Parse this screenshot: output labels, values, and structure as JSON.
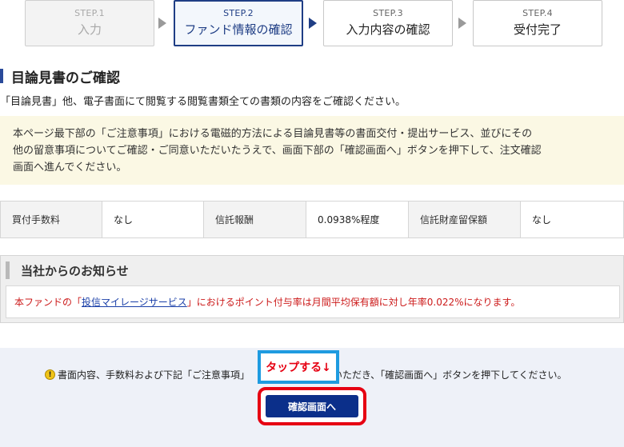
{
  "steps": [
    {
      "num": "STEP.1",
      "label": "入力",
      "state": "done"
    },
    {
      "num": "STEP.2",
      "label": "ファンド情報の確認",
      "state": "active"
    },
    {
      "num": "STEP.3",
      "label": "入力内容の確認",
      "state": "upcoming"
    },
    {
      "num": "STEP.4",
      "label": "受付完了",
      "state": "upcoming"
    }
  ],
  "heading": "目論見書のご確認",
  "intro": "「目論見書」他、電子書面にて閲覧する閲覧書類全ての書類の内容をご確認ください。",
  "notice": {
    "line1": "本ページ最下部の「ご注意事項」における電磁的方法による目論見書等の書面交付・提出サービス、並びにその",
    "line2": "他の留意事項についてご確認・ご同意いただいたうえで、画面下部の「確認画面へ」ボタンを押下して、注文確認",
    "line3": "画面へ進んでください。"
  },
  "fees": {
    "purchase_fee_label": "買付手数料",
    "purchase_fee_value": "なし",
    "trust_fee_label": "信託報酬",
    "trust_fee_value": "0.0938%程度",
    "retention_label": "信託財産留保額",
    "retention_value": "なし"
  },
  "company_notice": {
    "title": "当社からのお知らせ",
    "body_before": "本ファンドの「",
    "link": "投信マイレージサービス",
    "body_after": "」におけるポイント付与率は月間平均保有額に対し年率0.022%になります。"
  },
  "confirm": {
    "icon": "!",
    "text_before": "書面内容、手数料および下記「ご注意事項」",
    "text_after": "いただき、「確認画面へ」ボタンを押下してください。",
    "tap_annotation": "タップする↓",
    "button": "確認画面へ"
  },
  "colors": {
    "accent_blue": "#1f3e85",
    "button_navy": "#0b2f8a",
    "highlight_red": "#e60012",
    "highlight_cyan": "#1e9be0",
    "notice_bg": "#fbf8e4"
  }
}
